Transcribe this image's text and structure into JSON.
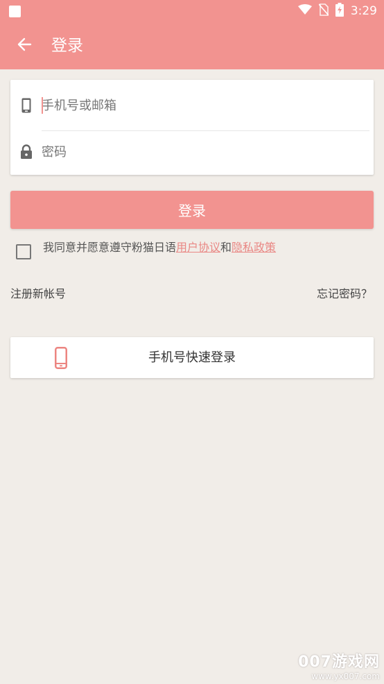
{
  "status_bar": {
    "time": "3:29",
    "icons": [
      "app-square-icon",
      "wifi-icon",
      "no-sim-icon",
      "battery-charging-icon"
    ]
  },
  "app_bar": {
    "back_icon": "back-arrow-icon",
    "title": "登录"
  },
  "form": {
    "account": {
      "icon": "phone-icon",
      "placeholder": "手机号或邮箱",
      "value": ""
    },
    "password": {
      "icon": "lock-icon",
      "placeholder": "密码",
      "value": ""
    }
  },
  "login_button": {
    "label": "登录"
  },
  "agreement": {
    "checked": false,
    "prefix": "我同意并愿意遵守粉猫日语",
    "user_agreement": "用户协议",
    "and": "和",
    "privacy_policy": "隐私政策"
  },
  "links": {
    "register": "注册新帐号",
    "forgot_password": "忘记密码？"
  },
  "quick_login": {
    "icon": "mobile-phone-icon",
    "label": "手机号快速登录"
  },
  "watermark": {
    "main": "007游戏网",
    "sub": "www.yx007.com"
  },
  "colors": {
    "accent": "#f29390",
    "background": "#f1ede8",
    "link": "#e98784"
  }
}
